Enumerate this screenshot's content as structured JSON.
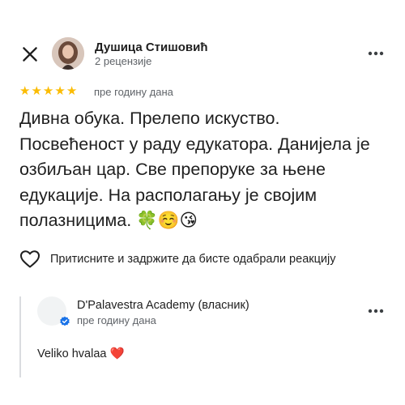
{
  "header": {
    "close_icon": "close-icon",
    "author": {
      "name": "Душица Стишовић",
      "meta": "2 рецензије"
    },
    "more_icon": "more-vert-icon"
  },
  "review": {
    "rating": 5,
    "star_glyph": "★",
    "star_color": "#fbbc04",
    "time": "пре годину дана",
    "text": "Дивна обука. Прелепо искуство. Посвећеност у раду едукатора. Данијела је озбиљан цар. Све препоруке за њене едукације. На располагању је својим полазницима. 🍀☺️😘"
  },
  "reaction": {
    "icon": "heart-outline-icon",
    "label": "Притисните и задржите да бисте одабрали реакцију"
  },
  "owner_reply": {
    "name": "D'Palavestra Academy (власник)",
    "badge_icon": "verified-icon",
    "badge_color": "#1a73e8",
    "time": "пре годину дана",
    "text": "Veliko hvalaa ❤️",
    "more_icon": "more-vert-icon"
  },
  "colors": {
    "text_primary": "#1f1f1f",
    "text_secondary": "#5f6368",
    "divider": "#dadce0"
  }
}
